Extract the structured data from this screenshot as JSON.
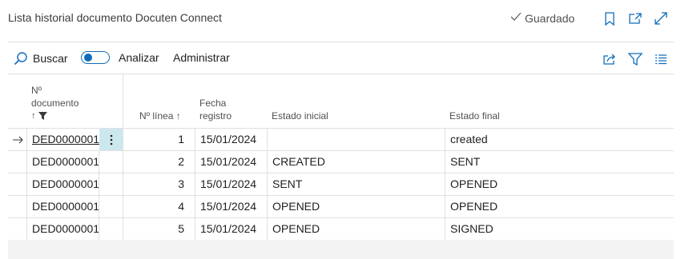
{
  "header": {
    "title": "Lista historial documento Docuten Connect",
    "saved_label": "Guardado",
    "icons": [
      "bookmark-icon",
      "open-new-window-icon",
      "expand-icon"
    ]
  },
  "actions": {
    "search_label": "Buscar",
    "analyze_label": "Analizar",
    "analyze_toggle_on": false,
    "manage_label": "Administrar",
    "right_icons": [
      "share-icon",
      "filter-icon",
      "list-view-icon"
    ]
  },
  "columns": {
    "doc_no_line1": "Nº",
    "doc_no_line2": "documento",
    "doc_no_sort": "↑",
    "line_no": "Nº línea ↑",
    "date_line1": "Fecha",
    "date_line2": "registro",
    "initial_state": "Estado inicial",
    "final_state": "Estado final"
  },
  "rows": [
    {
      "doc": "DED0000001",
      "line": "1",
      "date": "15/01/2024",
      "initial": "",
      "final": "created"
    },
    {
      "doc": "DED0000001",
      "line": "2",
      "date": "15/01/2024",
      "initial": "CREATED",
      "final": "SENT"
    },
    {
      "doc": "DED0000001",
      "line": "3",
      "date": "15/01/2024",
      "initial": "SENT",
      "final": "OPENED"
    },
    {
      "doc": "DED0000001",
      "line": "4",
      "date": "15/01/2024",
      "initial": "OPENED",
      "final": "OPENED"
    },
    {
      "doc": "DED0000001",
      "line": "5",
      "date": "15/01/2024",
      "initial": "OPENED",
      "final": "SIGNED"
    }
  ],
  "colors": {
    "accent": "#0f6cbd",
    "selected_cell": "#cce8ef"
  }
}
